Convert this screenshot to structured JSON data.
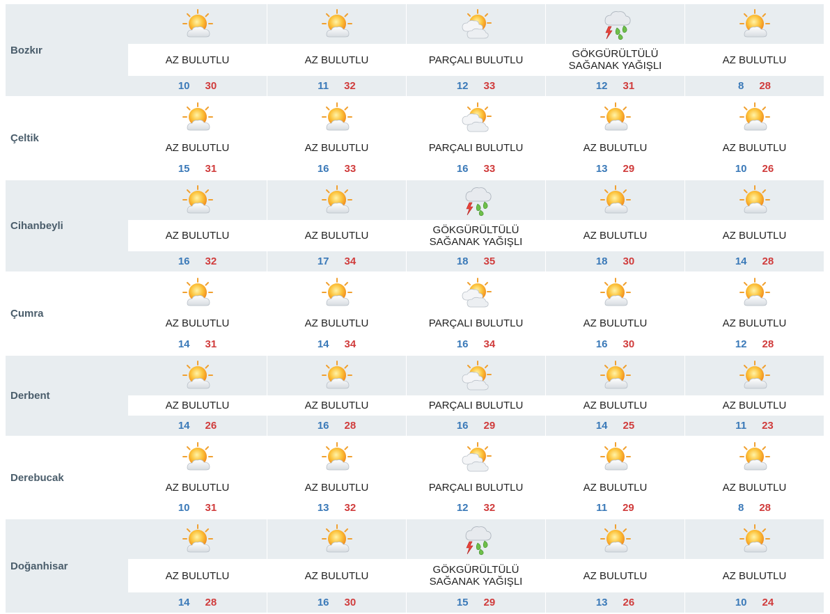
{
  "colors": {
    "row_bg": "#e8edf0",
    "min_temp": "#3a79b8",
    "max_temp": "#d03c3c",
    "city_name": "#4a5d6b"
  },
  "cities": [
    {
      "name": "Bozkır",
      "days": [
        {
          "icon": "partly-sunny-icon",
          "condition": "AZ BULUTLU",
          "min": "10",
          "max": "30"
        },
        {
          "icon": "partly-sunny-icon",
          "condition": "AZ BULUTLU",
          "min": "11",
          "max": "32"
        },
        {
          "icon": "cloudy-sun-icon",
          "condition": "PARÇALI BULUTLU",
          "min": "12",
          "max": "33"
        },
        {
          "icon": "thunderstorm-icon",
          "condition": "GÖKGÜRÜLTÜLÜ SAĞANAK YAĞIŞLI",
          "min": "12",
          "max": "31"
        },
        {
          "icon": "partly-sunny-icon",
          "condition": "AZ BULUTLU",
          "min": "8",
          "max": "28"
        }
      ]
    },
    {
      "name": "Çeltik",
      "days": [
        {
          "icon": "partly-sunny-icon",
          "condition": "AZ BULUTLU",
          "min": "15",
          "max": "31"
        },
        {
          "icon": "partly-sunny-icon",
          "condition": "AZ BULUTLU",
          "min": "16",
          "max": "33"
        },
        {
          "icon": "cloudy-sun-icon",
          "condition": "PARÇALI BULUTLU",
          "min": "16",
          "max": "33"
        },
        {
          "icon": "partly-sunny-icon",
          "condition": "AZ BULUTLU",
          "min": "13",
          "max": "29"
        },
        {
          "icon": "partly-sunny-icon",
          "condition": "AZ BULUTLU",
          "min": "10",
          "max": "26"
        }
      ]
    },
    {
      "name": "Cihanbeyli",
      "days": [
        {
          "icon": "partly-sunny-icon",
          "condition": "AZ BULUTLU",
          "min": "16",
          "max": "32"
        },
        {
          "icon": "partly-sunny-icon",
          "condition": "AZ BULUTLU",
          "min": "17",
          "max": "34"
        },
        {
          "icon": "thunderstorm-icon",
          "condition": "GÖKGÜRÜLTÜLÜ SAĞANAK YAĞIŞLI",
          "min": "18",
          "max": "35"
        },
        {
          "icon": "partly-sunny-icon",
          "condition": "AZ BULUTLU",
          "min": "18",
          "max": "30"
        },
        {
          "icon": "partly-sunny-icon",
          "condition": "AZ BULUTLU",
          "min": "14",
          "max": "28"
        }
      ]
    },
    {
      "name": "Çumra",
      "days": [
        {
          "icon": "partly-sunny-icon",
          "condition": "AZ BULUTLU",
          "min": "14",
          "max": "31"
        },
        {
          "icon": "partly-sunny-icon",
          "condition": "AZ BULUTLU",
          "min": "14",
          "max": "34"
        },
        {
          "icon": "cloudy-sun-icon",
          "condition": "PARÇALI BULUTLU",
          "min": "16",
          "max": "34"
        },
        {
          "icon": "partly-sunny-icon",
          "condition": "AZ BULUTLU",
          "min": "16",
          "max": "30"
        },
        {
          "icon": "partly-sunny-icon",
          "condition": "AZ BULUTLU",
          "min": "12",
          "max": "28"
        }
      ]
    },
    {
      "name": "Derbent",
      "days": [
        {
          "icon": "partly-sunny-icon",
          "condition": "AZ BULUTLU",
          "min": "14",
          "max": "26"
        },
        {
          "icon": "partly-sunny-icon",
          "condition": "AZ BULUTLU",
          "min": "16",
          "max": "28"
        },
        {
          "icon": "cloudy-sun-icon",
          "condition": "PARÇALI BULUTLU",
          "min": "16",
          "max": "29"
        },
        {
          "icon": "partly-sunny-icon",
          "condition": "AZ BULUTLU",
          "min": "14",
          "max": "25"
        },
        {
          "icon": "partly-sunny-icon",
          "condition": "AZ BULUTLU",
          "min": "11",
          "max": "23"
        }
      ]
    },
    {
      "name": "Derebucak",
      "days": [
        {
          "icon": "partly-sunny-icon",
          "condition": "AZ BULUTLU",
          "min": "10",
          "max": "31"
        },
        {
          "icon": "partly-sunny-icon",
          "condition": "AZ BULUTLU",
          "min": "13",
          "max": "32"
        },
        {
          "icon": "cloudy-sun-icon",
          "condition": "PARÇALI BULUTLU",
          "min": "12",
          "max": "32"
        },
        {
          "icon": "partly-sunny-icon",
          "condition": "AZ BULUTLU",
          "min": "11",
          "max": "29"
        },
        {
          "icon": "partly-sunny-icon",
          "condition": "AZ BULUTLU",
          "min": "8",
          "max": "28"
        }
      ]
    },
    {
      "name": "Doğanhisar",
      "days": [
        {
          "icon": "partly-sunny-icon",
          "condition": "AZ BULUTLU",
          "min": "14",
          "max": "28"
        },
        {
          "icon": "partly-sunny-icon",
          "condition": "AZ BULUTLU",
          "min": "16",
          "max": "30"
        },
        {
          "icon": "thunderstorm-icon",
          "condition": "GÖKGÜRÜLTÜLÜ SAĞANAK YAĞIŞLI",
          "min": "15",
          "max": "29"
        },
        {
          "icon": "partly-sunny-icon",
          "condition": "AZ BULUTLU",
          "min": "13",
          "max": "26"
        },
        {
          "icon": "partly-sunny-icon",
          "condition": "AZ BULUTLU",
          "min": "10",
          "max": "24"
        }
      ]
    }
  ]
}
